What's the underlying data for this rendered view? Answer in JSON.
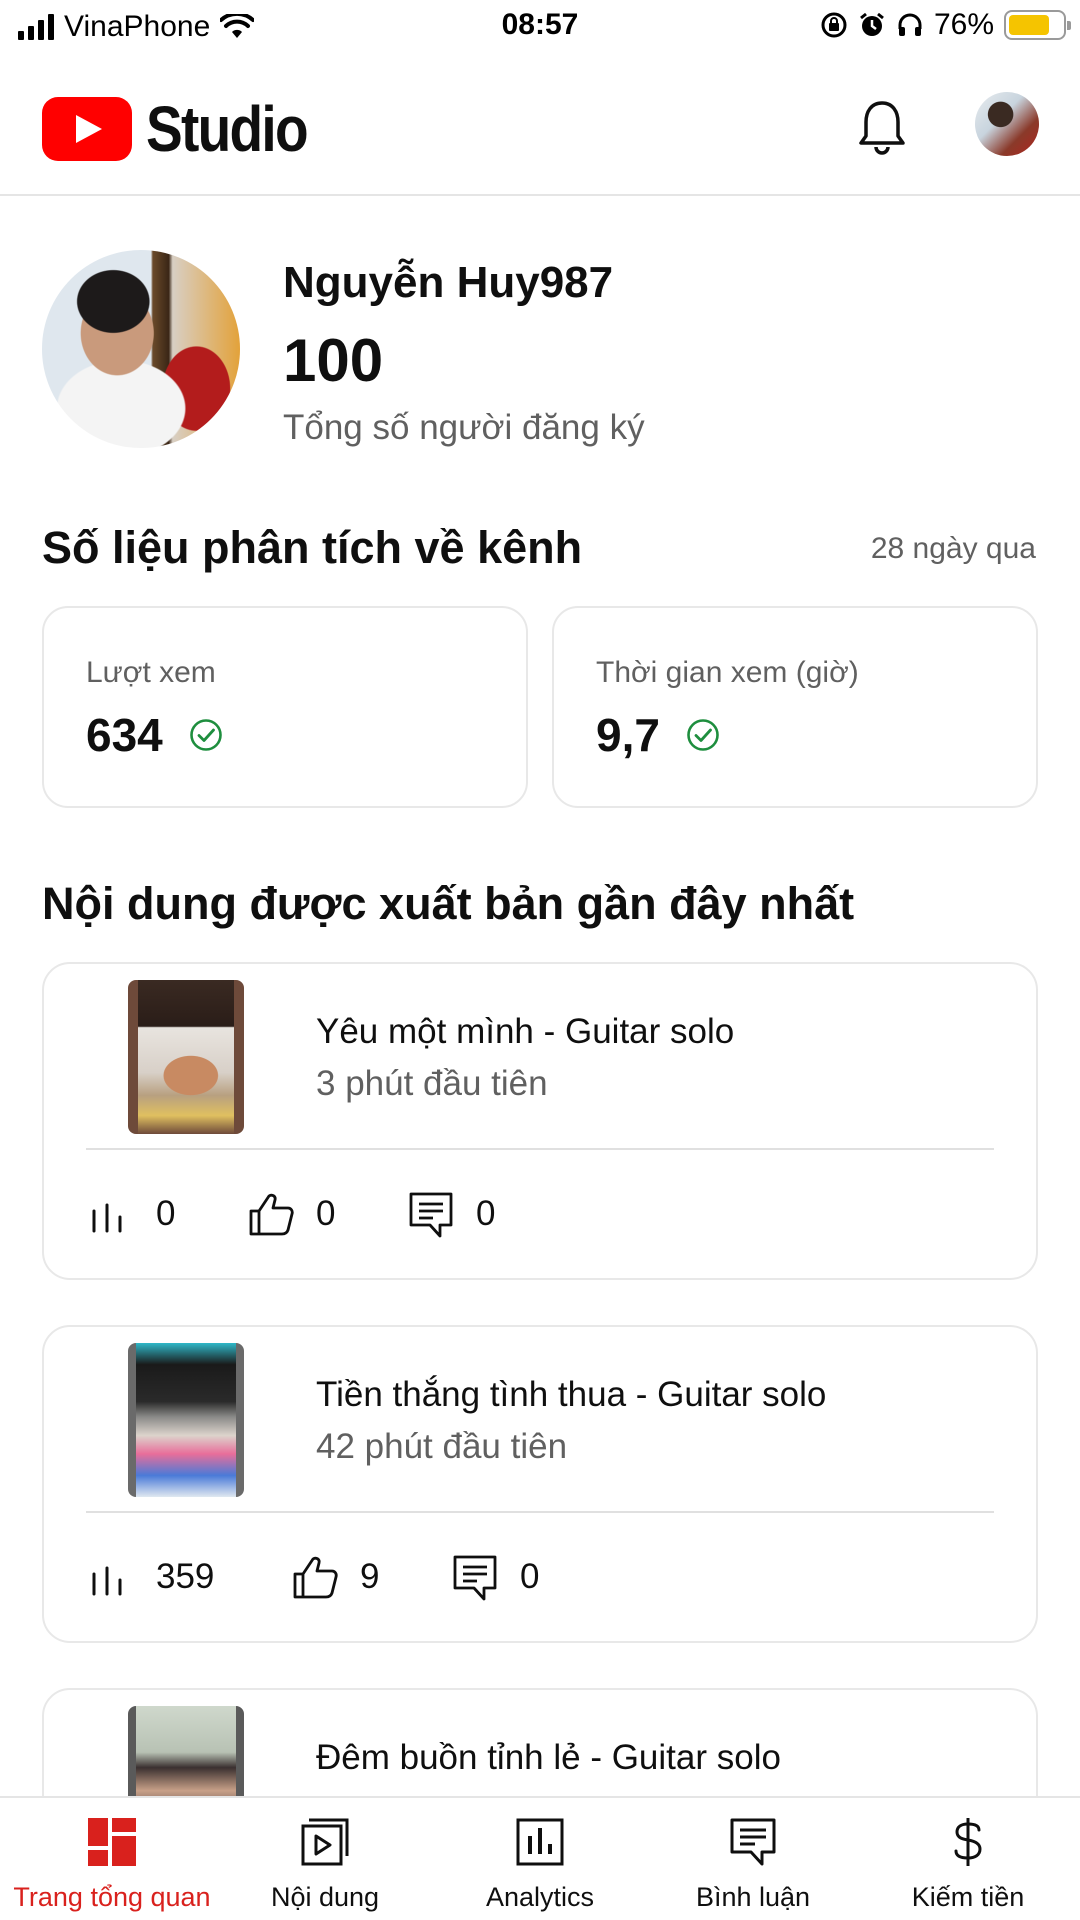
{
  "status_bar": {
    "carrier": "VinaPhone",
    "time": "08:57",
    "battery_percent": "76%",
    "battery_level": 0.76
  },
  "header": {
    "logo_text": "Studio",
    "brand_color": "#ff0000"
  },
  "profile": {
    "channel_name": "Nguyễn Huy987",
    "subscriber_count": "100",
    "subscriber_label": "Tổng số người đăng ký"
  },
  "analytics": {
    "title": "Số liệu phân tích về kênh",
    "period": "28 ngày qua",
    "metrics": [
      {
        "label": "Lượt xem",
        "value": "634"
      },
      {
        "label": "Thời gian xem (giờ)",
        "value": "9,7"
      }
    ],
    "check_color": "#1e8e3e"
  },
  "recent": {
    "title": "Nội dung được xuất bản gần đây nhất",
    "videos": [
      {
        "title": "Yêu một mình - Guitar solo",
        "subtitle": "3 phút đầu tiên",
        "views": "0",
        "likes": "0",
        "comments": "0"
      },
      {
        "title": "Tiền thắng tình thua - Guitar solo",
        "subtitle": "42 phút đầu tiên",
        "views": "359",
        "likes": "9",
        "comments": "0"
      },
      {
        "title": "Đêm buồn tỉnh lẻ - Guitar solo"
      }
    ]
  },
  "bottom_nav": {
    "active_color": "#d9211d",
    "items": [
      {
        "label": "Trang tổng quan",
        "icon": "dashboard-icon"
      },
      {
        "label": "Nội dung",
        "icon": "content-icon"
      },
      {
        "label": "Analytics",
        "icon": "analytics-icon"
      },
      {
        "label": "Bình luận",
        "icon": "comments-icon"
      },
      {
        "label": "Kiếm tiền",
        "icon": "dollar-icon"
      }
    ]
  }
}
